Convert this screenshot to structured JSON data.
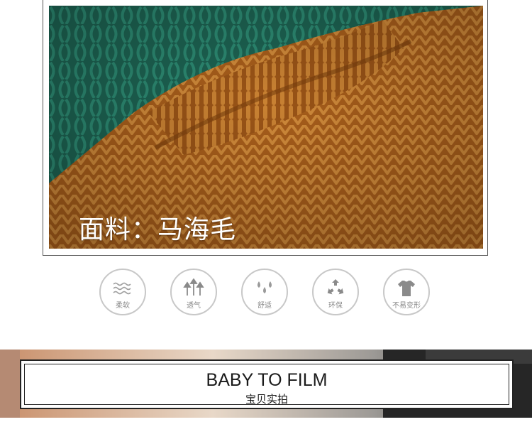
{
  "fabric": {
    "caption": "面料：马海毛"
  },
  "features": [
    {
      "icon": "wave-icon",
      "label": "柔软"
    },
    {
      "icon": "arrows-up-icon",
      "label": "透气"
    },
    {
      "icon": "droplets-icon",
      "label": "舒适"
    },
    {
      "icon": "recycle-icon",
      "label": "环保"
    },
    {
      "icon": "shirt-icon",
      "label": "不易变形"
    }
  ],
  "banner": {
    "title": "BABY TO FILM",
    "subtitle": "宝贝实拍"
  },
  "colors": {
    "sweater": "#b3691f",
    "knit_green": "#1f6b5a",
    "icon_stroke": "#c8c8c8",
    "label_gray": "#8a8a8a"
  }
}
